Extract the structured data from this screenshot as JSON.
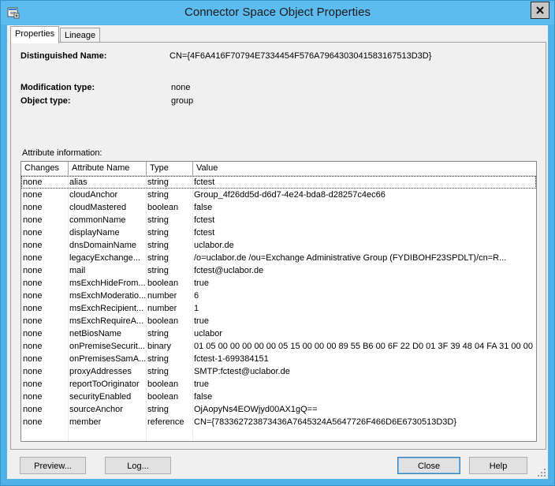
{
  "window": {
    "title": "Connector Space Object Properties"
  },
  "tabs": [
    {
      "label": "Properties",
      "active": true
    },
    {
      "label": "Lineage",
      "active": false
    }
  ],
  "properties": {
    "dn_label": "Distinguished Name:",
    "dn_value": "CN={4F6A416F70794E7334454F576A7964303041583167513D3D}",
    "mod_type_label": "Modification type:",
    "mod_type_value": "none",
    "obj_type_label": "Object type:",
    "obj_type_value": "group"
  },
  "attributes": {
    "caption": "Attribute information:",
    "columns": [
      "Changes",
      "Attribute Name",
      "Type",
      "Value"
    ],
    "rows": [
      {
        "changes": "none",
        "name": "alias",
        "type": "string",
        "value": "fctest"
      },
      {
        "changes": "none",
        "name": "cloudAnchor",
        "type": "string",
        "value": "Group_4f26dd5d-d6d7-4e24-bda8-d28257c4ec66"
      },
      {
        "changes": "none",
        "name": "cloudMastered",
        "type": "boolean",
        "value": "false"
      },
      {
        "changes": "none",
        "name": "commonName",
        "type": "string",
        "value": "fctest"
      },
      {
        "changes": "none",
        "name": "displayName",
        "type": "string",
        "value": "fctest"
      },
      {
        "changes": "none",
        "name": "dnsDomainName",
        "type": "string",
        "value": "uclabor.de"
      },
      {
        "changes": "none",
        "name": "legacyExchange...",
        "type": "string",
        "value": "/o=uclabor.de /ou=Exchange Administrative Group (FYDIBOHF23SPDLT)/cn=R..."
      },
      {
        "changes": "none",
        "name": "mail",
        "type": "string",
        "value": "fctest@uclabor.de"
      },
      {
        "changes": "none",
        "name": "msExchHideFrom...",
        "type": "boolean",
        "value": "true"
      },
      {
        "changes": "none",
        "name": "msExchModeratio...",
        "type": "number",
        "value": "6"
      },
      {
        "changes": "none",
        "name": "msExchRecipient...",
        "type": "number",
        "value": "1"
      },
      {
        "changes": "none",
        "name": "msExchRequireA...",
        "type": "boolean",
        "value": "true"
      },
      {
        "changes": "none",
        "name": "netBiosName",
        "type": "string",
        "value": "uclabor"
      },
      {
        "changes": "none",
        "name": "onPremiseSecurit...",
        "type": "binary",
        "value": "01 05 00 00 00 00 00 05 15 00 00 00 89 55 B6 00 6F 22 D0 01 3F 39 48 04 FA 31 00 00"
      },
      {
        "changes": "none",
        "name": "onPremisesSamA...",
        "type": "string",
        "value": "fctest-1-699384151"
      },
      {
        "changes": "none",
        "name": "proxyAddresses",
        "type": "string",
        "value": "SMTP:fctest@uclabor.de"
      },
      {
        "changes": "none",
        "name": "reportToOriginator",
        "type": "boolean",
        "value": "true"
      },
      {
        "changes": "none",
        "name": "securityEnabled",
        "type": "boolean",
        "value": "false"
      },
      {
        "changes": "none",
        "name": "sourceAnchor",
        "type": "string",
        "value": "OjAopyNs4EOWjyd00AX1gQ=="
      },
      {
        "changes": "none",
        "name": "member",
        "type": "reference",
        "value": "CN={783362723873436A7645324A5647726F466D6E6730513D3D}"
      }
    ]
  },
  "buttons": {
    "preview": "Preview...",
    "log": "Log...",
    "close": "Close",
    "help": "Help"
  },
  "icons": {
    "app": "properties-window-icon",
    "close": "close-icon",
    "grip": "resize-grip-icon"
  },
  "colors": {
    "titlebar": "#5cbcef",
    "client": "#f0f0f0",
    "focus_outline": "#333333"
  }
}
